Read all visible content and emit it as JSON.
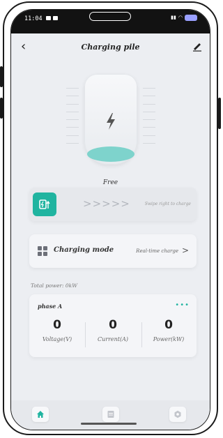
{
  "status_bar": {
    "time": "11:04"
  },
  "header": {
    "title": "Charging pile",
    "back_icon": "chevron-left-icon",
    "edit_icon": "pencil-icon"
  },
  "charger": {
    "status": "Free",
    "bolt_icon": "lightning-bolt-icon"
  },
  "swipe": {
    "hint": "Swipe right to charge",
    "chevrons": ">>>>>",
    "accent": "#20b4a0"
  },
  "mode": {
    "label": "Charging mode",
    "value": "Real-time charge",
    "chevron": ">"
  },
  "total_power": "Total power: 0kW",
  "phase": {
    "title": "phase A",
    "metrics": [
      {
        "value": "0",
        "label": "Voltage(V)"
      },
      {
        "value": "0",
        "label": "Current(A)"
      },
      {
        "value": "0",
        "label": "Power(kW)"
      }
    ]
  },
  "tabbar": {
    "tabs": [
      "home-icon",
      "document-icon",
      "settings-icon"
    ]
  }
}
